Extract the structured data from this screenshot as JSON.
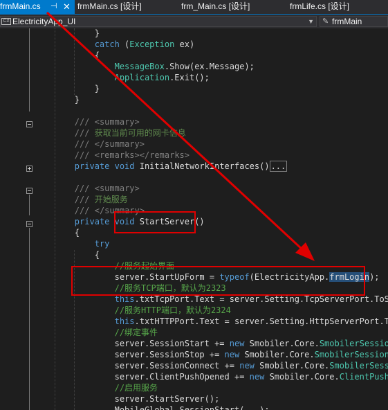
{
  "tabs": [
    {
      "label": "frmMain.cs",
      "pin": "⊣",
      "close": "✕"
    },
    {
      "label": "frmMain.cs [设计]"
    },
    {
      "label": "frm_Main.cs [设计]"
    },
    {
      "label": "frmLife.cs [设计]"
    }
  ],
  "nav": {
    "project": "ElectricityApp_UI",
    "class_label": "frmMain",
    "class_icon": "class-icon",
    "dropdown_icon": "chevron-down-icon"
  },
  "code_lines": [
    [
      [
        "p",
        "            }"
      ]
    ],
    [
      [
        "k",
        "            catch"
      ],
      [
        "p",
        " ("
      ],
      [
        "t",
        "Exception"
      ],
      [
        "p",
        " ex)"
      ]
    ],
    [
      [
        "p",
        "            {"
      ]
    ],
    [
      [
        "p",
        "                "
      ],
      [
        "t",
        "MessageBox"
      ],
      [
        "p",
        ".Show(ex.Message);"
      ]
    ],
    [
      [
        "p",
        "                "
      ],
      [
        "t",
        "Application"
      ],
      [
        "p",
        ".Exit();"
      ]
    ],
    [
      [
        "p",
        "            }"
      ]
    ],
    [
      [
        "p",
        "        }"
      ]
    ],
    [
      [
        "p",
        ""
      ]
    ],
    [
      [
        "g",
        "        ///"
      ],
      [
        "d",
        " "
      ],
      [
        "g",
        "<summary>"
      ]
    ],
    [
      [
        "g",
        "        ///"
      ],
      [
        "d",
        " 获取当前可用的网卡信息"
      ]
    ],
    [
      [
        "g",
        "        ///"
      ],
      [
        "d",
        " "
      ],
      [
        "g",
        "</summary>"
      ]
    ],
    [
      [
        "g",
        "        ///"
      ],
      [
        "d",
        " "
      ],
      [
        "g",
        "<remarks></remarks>"
      ]
    ],
    [
      [
        "k",
        "        private void"
      ],
      [
        "p",
        " InitialNetworkInterfaces()"
      ],
      [
        "c",
        "..."
      ]
    ],
    [
      [
        "p",
        ""
      ]
    ],
    [
      [
        "g",
        "        ///"
      ],
      [
        "d",
        " "
      ],
      [
        "g",
        "<summary>"
      ]
    ],
    [
      [
        "g",
        "        ///"
      ],
      [
        "d",
        " 开始服务"
      ]
    ],
    [
      [
        "g",
        "        ///"
      ],
      [
        "d",
        " "
      ],
      [
        "g",
        "</summary>"
      ]
    ],
    [
      [
        "k",
        "        private void"
      ],
      [
        "p",
        " StartServer()"
      ]
    ],
    [
      [
        "p",
        "        {"
      ]
    ],
    [
      [
        "k",
        "            try"
      ]
    ],
    [
      [
        "p",
        "            {"
      ]
    ],
    [
      [
        "m",
        "                //服务起始界面"
      ]
    ],
    [
      [
        "p",
        "                server.StartUpForm = "
      ],
      [
        "k",
        "typeof"
      ],
      [
        "p",
        "(ElectricityApp."
      ],
      [
        "s",
        "frmLogin"
      ],
      [
        "p",
        ");"
      ]
    ],
    [
      [
        "m",
        "                //服务TCP端口，默认为2323"
      ]
    ],
    [
      [
        "k",
        "                this"
      ],
      [
        "p",
        ".txtTcpPort.Text = server.Setting.TcpServerPort.ToString("
      ]
    ],
    [
      [
        "m",
        "                //服务HTTP端口，默认为2324"
      ]
    ],
    [
      [
        "k",
        "                this"
      ],
      [
        "p",
        ".txtHTTPPort.Text = server.Setting.HttpServerPort.ToStrin"
      ]
    ],
    [
      [
        "m",
        "                //绑定事件"
      ]
    ],
    [
      [
        "p",
        "                server.SessionStart += "
      ],
      [
        "k",
        "new"
      ],
      [
        "p",
        " Smobiler.Core."
      ],
      [
        "t",
        "SmobilerSessionEvent"
      ]
    ],
    [
      [
        "p",
        "                server.SessionStop += "
      ],
      [
        "k",
        "new"
      ],
      [
        "p",
        " Smobiler.Core."
      ],
      [
        "t",
        "SmobilerSessionEventH"
      ]
    ],
    [
      [
        "p",
        "                server.SessionConnect += "
      ],
      [
        "k",
        "new"
      ],
      [
        "p",
        " Smobiler.Core."
      ],
      [
        "t",
        "SmobilerSessionEve"
      ]
    ],
    [
      [
        "p",
        "                server.ClientPushOpened += "
      ],
      [
        "k",
        "new"
      ],
      [
        "p",
        " Smobiler.Core."
      ],
      [
        "t",
        "ClientPushOpened"
      ]
    ],
    [
      [
        "m",
        "                //启用服务"
      ]
    ],
    [
      [
        "p",
        "                server.StartServer();"
      ]
    ],
    [
      [
        "p",
        "                MobileGlobal.SessionStart(...);"
      ]
    ]
  ],
  "annotation": {
    "color": "#e00000",
    "highlight_1_text": "StartServer()",
    "highlight_2_text": "server.StartUpForm = typeof(ElectricityApp.frmLogin);"
  }
}
